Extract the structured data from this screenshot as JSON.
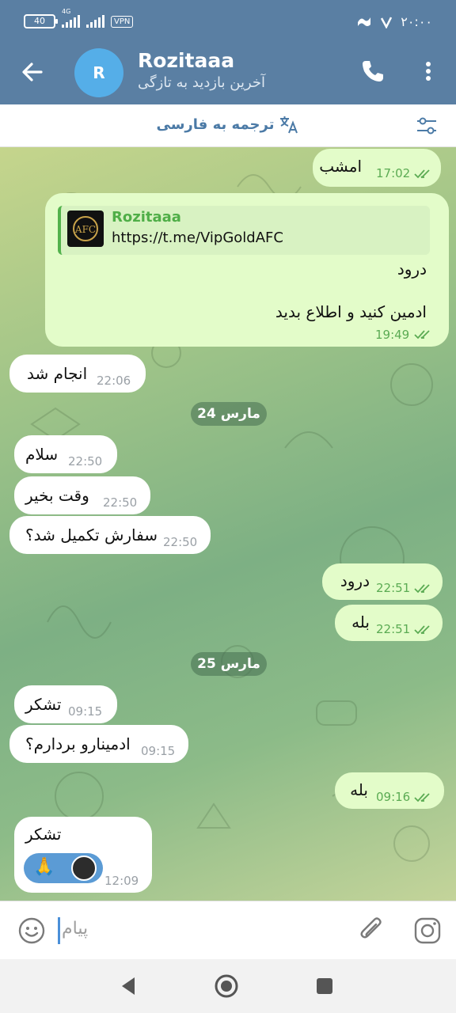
{
  "status_bar": {
    "battery": "40",
    "network": "4G",
    "vpn": "VPN",
    "time": "۲۰:۰۰"
  },
  "header": {
    "avatar_letter": "R",
    "contact_name": "Rozitaaa",
    "last_seen": "آخرین بازدید به تازگی"
  },
  "translate_bar": {
    "label": "ترجمه به فارسی"
  },
  "messages": [
    {
      "dir": "out",
      "text": "امشب",
      "time": "17:02"
    },
    {
      "dir": "out",
      "quote_name": "Rozitaaa",
      "quote_link": "https://t.me/VipGoldAFC",
      "line1": "درود",
      "line2": "ادمین کنید و اطلاع بدید",
      "time": "19:49"
    },
    {
      "dir": "in",
      "text": "انجام شد",
      "time": "22:06"
    },
    {
      "dir": "in",
      "text": "سلام",
      "time": "22:50"
    },
    {
      "dir": "in",
      "text": "وقت بخیر",
      "time": "22:50"
    },
    {
      "dir": "in",
      "text": "سفارش تکمیل شد؟",
      "time": "22:50"
    },
    {
      "dir": "out",
      "text": "درود",
      "time": "22:51"
    },
    {
      "dir": "out",
      "text": "بله",
      "time": "22:51"
    },
    {
      "dir": "in",
      "text": "تشکر",
      "time": "09:15"
    },
    {
      "dir": "in",
      "text": "ادمینارو بردارم؟",
      "time": "09:15"
    },
    {
      "dir": "out",
      "text": "بله",
      "time": "09:16"
    },
    {
      "dir": "in",
      "text": "تشکر",
      "time": "12:09",
      "reaction": "🙏"
    }
  ],
  "date_separators": [
    "24 مارس",
    "25 مارس"
  ],
  "input": {
    "placeholder": "پیام"
  },
  "colors": {
    "header": "#5a7fa3",
    "outgoing_bubble": "#e3fcc9",
    "incoming_bubble": "#ffffff",
    "accent": "#4fae47"
  },
  "icons": [
    "back-arrow-icon",
    "phone-icon",
    "more-vertical-icon",
    "translate-icon",
    "filter-icon",
    "double-check-icon",
    "emoji-icon",
    "attach-icon",
    "camera-icon",
    "nav-back-icon",
    "nav-home-icon",
    "nav-recents-icon"
  ]
}
